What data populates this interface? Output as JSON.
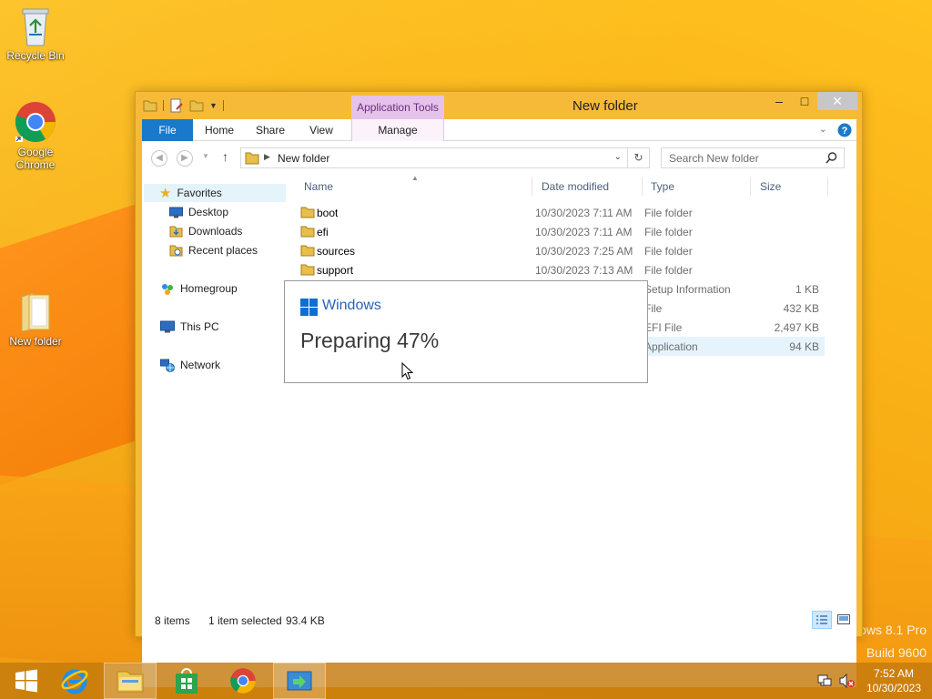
{
  "desktop": {
    "icons": [
      {
        "label": "Recycle Bin",
        "icon": "recycle-bin-icon"
      },
      {
        "label": "Google Chrome",
        "icon": "chrome-icon"
      },
      {
        "label": "New folder",
        "icon": "folder-icon"
      }
    ],
    "watermark": {
      "line1": "dows 8.1 Pro",
      "line2": "Build 9600"
    }
  },
  "window": {
    "title": "New folder",
    "context_tab_group": "Application Tools",
    "buttons": {
      "minimize": "–",
      "maximize": "□",
      "close": "✕"
    },
    "ribbon_tabs": [
      {
        "label": "File"
      },
      {
        "label": "Home"
      },
      {
        "label": "Share"
      },
      {
        "label": "View"
      },
      {
        "label": "Manage"
      }
    ],
    "address": {
      "path": "New folder"
    },
    "search": {
      "placeholder": "Search New folder"
    },
    "nav_pane": {
      "favorites": "Favorites",
      "desktop": "Desktop",
      "downloads": "Downloads",
      "recent": "Recent places",
      "homegroup": "Homegroup",
      "this_pc": "This PC",
      "network": "Network"
    },
    "columns": {
      "name": "Name",
      "date": "Date modified",
      "type": "Type",
      "size": "Size"
    },
    "files": [
      {
        "name": "boot",
        "date": "10/30/2023 7:11 AM",
        "type": "File folder",
        "size": ""
      },
      {
        "name": "efi",
        "date": "10/30/2023 7:11 AM",
        "type": "File folder",
        "size": ""
      },
      {
        "name": "sources",
        "date": "10/30/2023 7:25 AM",
        "type": "File folder",
        "size": ""
      },
      {
        "name": "support",
        "date": "10/30/2023 7:13 AM",
        "type": "File folder",
        "size": ""
      },
      {
        "name": "",
        "date": "",
        "type": "Setup Information",
        "size": "1 KB"
      },
      {
        "name": "",
        "date": "",
        "type": "File",
        "size": "432 KB"
      },
      {
        "name": "",
        "date": "",
        "type": "EFI File",
        "size": "2,497 KB"
      },
      {
        "name": "",
        "date": "",
        "type": "Application",
        "size": "94 KB"
      }
    ],
    "status": {
      "items": "8 items",
      "selected": "1 item selected",
      "selected_size": "93.4 KB"
    }
  },
  "setup_dialog": {
    "brand": "Windows",
    "status": "Preparing 47%",
    "progress_percent": 47
  },
  "taskbar": {
    "clock_time": "7:52 AM",
    "clock_date": "10/30/2023"
  },
  "colors": {
    "accent": "#1979ca",
    "context_tab": "#e5c2ea",
    "desktop": "#f3a51b",
    "selection": "#e5f3fb"
  }
}
